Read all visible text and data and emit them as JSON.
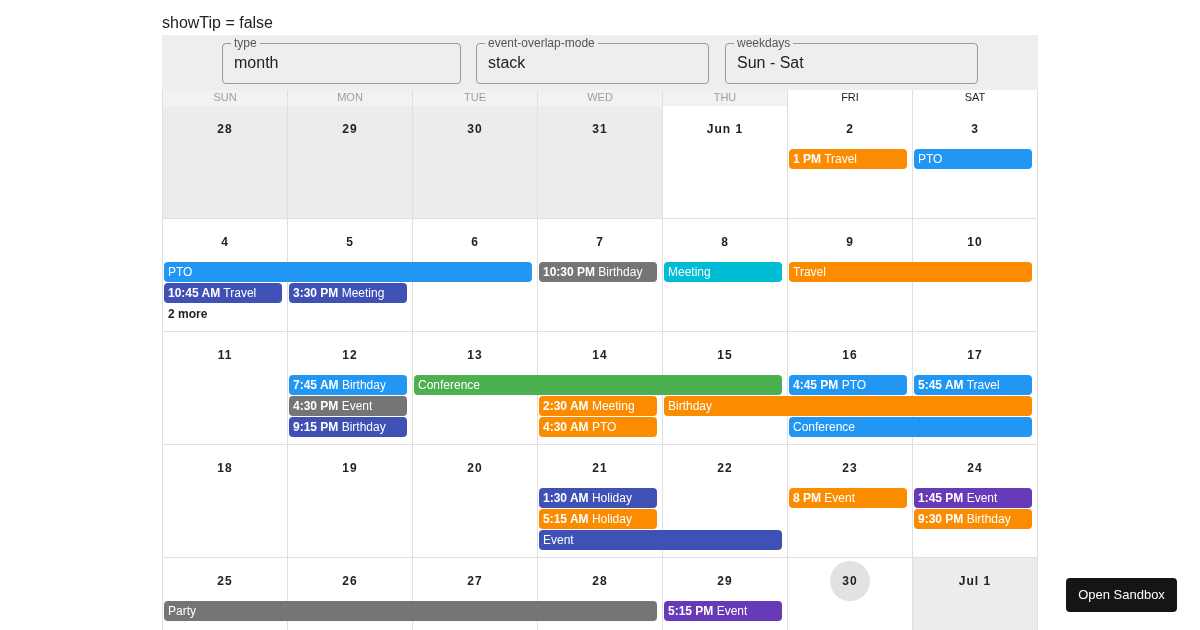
{
  "show_tip_label": "showTip = false",
  "controls": [
    {
      "label": "type",
      "value": "month"
    },
    {
      "label": "event-overlap-mode",
      "value": "stack"
    },
    {
      "label": "weekdays",
      "value": "Sun - Sat"
    }
  ],
  "weekday_headers": [
    {
      "label": "SUN",
      "past": true
    },
    {
      "label": "MON",
      "past": true
    },
    {
      "label": "TUE",
      "past": true
    },
    {
      "label": "WED",
      "past": true
    },
    {
      "label": "THU",
      "past": true
    },
    {
      "label": "FRI",
      "past": false
    },
    {
      "label": "SAT",
      "past": false
    }
  ],
  "weeks": [
    {
      "days": [
        {
          "date": "28",
          "shaded": true,
          "today": false
        },
        {
          "date": "29",
          "shaded": true,
          "today": false
        },
        {
          "date": "30",
          "shaded": true,
          "today": false
        },
        {
          "date": "31",
          "shaded": true,
          "today": false
        },
        {
          "date": "Jun 1",
          "shaded": false,
          "today": false
        },
        {
          "date": "2",
          "shaded": false,
          "today": false
        },
        {
          "date": "3",
          "shaded": false,
          "today": false
        }
      ],
      "lanes": [
        [
          {
            "kind": "empty"
          },
          {
            "kind": "empty"
          },
          {
            "kind": "empty"
          },
          {
            "kind": "empty"
          },
          {
            "kind": "empty"
          },
          {
            "kind": "event",
            "time": "1 PM",
            "title": "Travel",
            "color": "#fb8c00"
          },
          {
            "kind": "event",
            "title": "PTO",
            "color": "#2196f3"
          }
        ]
      ]
    },
    {
      "days": [
        {
          "date": "4",
          "shaded": false,
          "today": false
        },
        {
          "date": "5",
          "shaded": false,
          "today": false
        },
        {
          "date": "6",
          "shaded": false,
          "today": false
        },
        {
          "date": "7",
          "shaded": false,
          "today": false
        },
        {
          "date": "8",
          "shaded": false,
          "today": false
        },
        {
          "date": "9",
          "shaded": false,
          "today": false
        },
        {
          "date": "10",
          "shaded": false,
          "today": false
        }
      ],
      "lanes": [
        [
          {
            "kind": "event",
            "title": "PTO",
            "color": "#2196f3"
          },
          {
            "kind": "continued"
          },
          {
            "kind": "continued"
          },
          {
            "kind": "event",
            "time": "10:30 PM",
            "title": "Birthday",
            "color": "#757575"
          },
          {
            "kind": "event",
            "title": "Meeting",
            "color": "#00bcd4"
          },
          {
            "kind": "event",
            "title": "Travel",
            "color": "#fb8c00"
          },
          {
            "kind": "continued"
          }
        ],
        [
          {
            "kind": "event",
            "time": "10:45 AM",
            "title": "Travel",
            "color": "#3f51b5"
          },
          {
            "kind": "event",
            "time": "3:30 PM",
            "title": "Meeting",
            "color": "#3f51b5"
          }
        ],
        [
          {
            "kind": "more",
            "text": "2 more"
          }
        ]
      ]
    },
    {
      "days": [
        {
          "date": "11",
          "shaded": false,
          "today": false
        },
        {
          "date": "12",
          "shaded": false,
          "today": false
        },
        {
          "date": "13",
          "shaded": false,
          "today": false
        },
        {
          "date": "14",
          "shaded": false,
          "today": false
        },
        {
          "date": "15",
          "shaded": false,
          "today": false
        },
        {
          "date": "16",
          "shaded": false,
          "today": false
        },
        {
          "date": "17",
          "shaded": false,
          "today": false
        }
      ],
      "lanes": [
        [
          {
            "kind": "empty"
          },
          {
            "kind": "event",
            "time": "7:45 AM",
            "title": "Birthday",
            "color": "#2196f3"
          },
          {
            "kind": "event",
            "title": "Conference",
            "color": "#4caf50"
          },
          {
            "kind": "continued"
          },
          {
            "kind": "continued"
          },
          {
            "kind": "event",
            "time": "4:45 PM",
            "title": "PTO",
            "color": "#2196f3"
          },
          {
            "kind": "event",
            "time": "5:45 AM",
            "title": "Travel",
            "color": "#2196f3"
          }
        ],
        [
          {
            "kind": "empty"
          },
          {
            "kind": "event",
            "time": "4:30 PM",
            "title": "Event",
            "color": "#757575"
          },
          {
            "kind": "empty"
          },
          {
            "kind": "event",
            "time": "2:30 AM",
            "title": "Meeting",
            "color": "#fb8c00"
          },
          {
            "kind": "event",
            "title": "Birthday",
            "color": "#fb8c00"
          },
          {
            "kind": "continued"
          },
          {
            "kind": "continued"
          }
        ],
        [
          {
            "kind": "empty"
          },
          {
            "kind": "event",
            "time": "9:15 PM",
            "title": "Birthday",
            "color": "#3f51b5"
          },
          {
            "kind": "empty"
          },
          {
            "kind": "event",
            "time": "4:30 AM",
            "title": "PTO",
            "color": "#fb8c00"
          },
          {
            "kind": "empty"
          },
          {
            "kind": "event",
            "title": "Conference",
            "color": "#2196f3"
          },
          {
            "kind": "continued"
          }
        ]
      ]
    },
    {
      "days": [
        {
          "date": "18",
          "shaded": false,
          "today": false
        },
        {
          "date": "19",
          "shaded": false,
          "today": false
        },
        {
          "date": "20",
          "shaded": false,
          "today": false
        },
        {
          "date": "21",
          "shaded": false,
          "today": false
        },
        {
          "date": "22",
          "shaded": false,
          "today": false
        },
        {
          "date": "23",
          "shaded": false,
          "today": false
        },
        {
          "date": "24",
          "shaded": false,
          "today": false
        }
      ],
      "lanes": [
        [
          {
            "kind": "empty"
          },
          {
            "kind": "empty"
          },
          {
            "kind": "empty"
          },
          {
            "kind": "event",
            "time": "1:30 AM",
            "title": "Holiday",
            "color": "#3f51b5"
          },
          {
            "kind": "empty"
          },
          {
            "kind": "event",
            "time": "8 PM",
            "title": "Event",
            "color": "#fb8c00"
          },
          {
            "kind": "event",
            "time": "1:45 PM",
            "title": "Event",
            "color": "#673ab7"
          }
        ],
        [
          {
            "kind": "empty"
          },
          {
            "kind": "empty"
          },
          {
            "kind": "empty"
          },
          {
            "kind": "event",
            "time": "5:15 AM",
            "title": "Holiday",
            "color": "#fb8c00"
          },
          {
            "kind": "empty"
          },
          {
            "kind": "empty"
          },
          {
            "kind": "event",
            "time": "9:30 PM",
            "title": "Birthday",
            "color": "#fb8c00"
          }
        ],
        [
          {
            "kind": "empty"
          },
          {
            "kind": "empty"
          },
          {
            "kind": "empty"
          },
          {
            "kind": "event",
            "title": "Event",
            "color": "#3f51b5"
          },
          {
            "kind": "continued"
          }
        ]
      ]
    },
    {
      "days": [
        {
          "date": "25",
          "shaded": false,
          "today": false
        },
        {
          "date": "26",
          "shaded": false,
          "today": false
        },
        {
          "date": "27",
          "shaded": false,
          "today": false
        },
        {
          "date": "28",
          "shaded": false,
          "today": false
        },
        {
          "date": "29",
          "shaded": false,
          "today": false
        },
        {
          "date": "30",
          "shaded": false,
          "today": true
        },
        {
          "date": "Jul 1",
          "shaded": true,
          "today": false
        }
      ],
      "lanes": [
        [
          {
            "kind": "event",
            "title": "Party",
            "color": "#757575"
          },
          {
            "kind": "continued"
          },
          {
            "kind": "continued"
          },
          {
            "kind": "continued"
          },
          {
            "kind": "event",
            "time": "5:15 PM",
            "title": "Event",
            "color": "#673ab7"
          }
        ]
      ]
    }
  ],
  "sandbox_button": "Open Sandbox"
}
